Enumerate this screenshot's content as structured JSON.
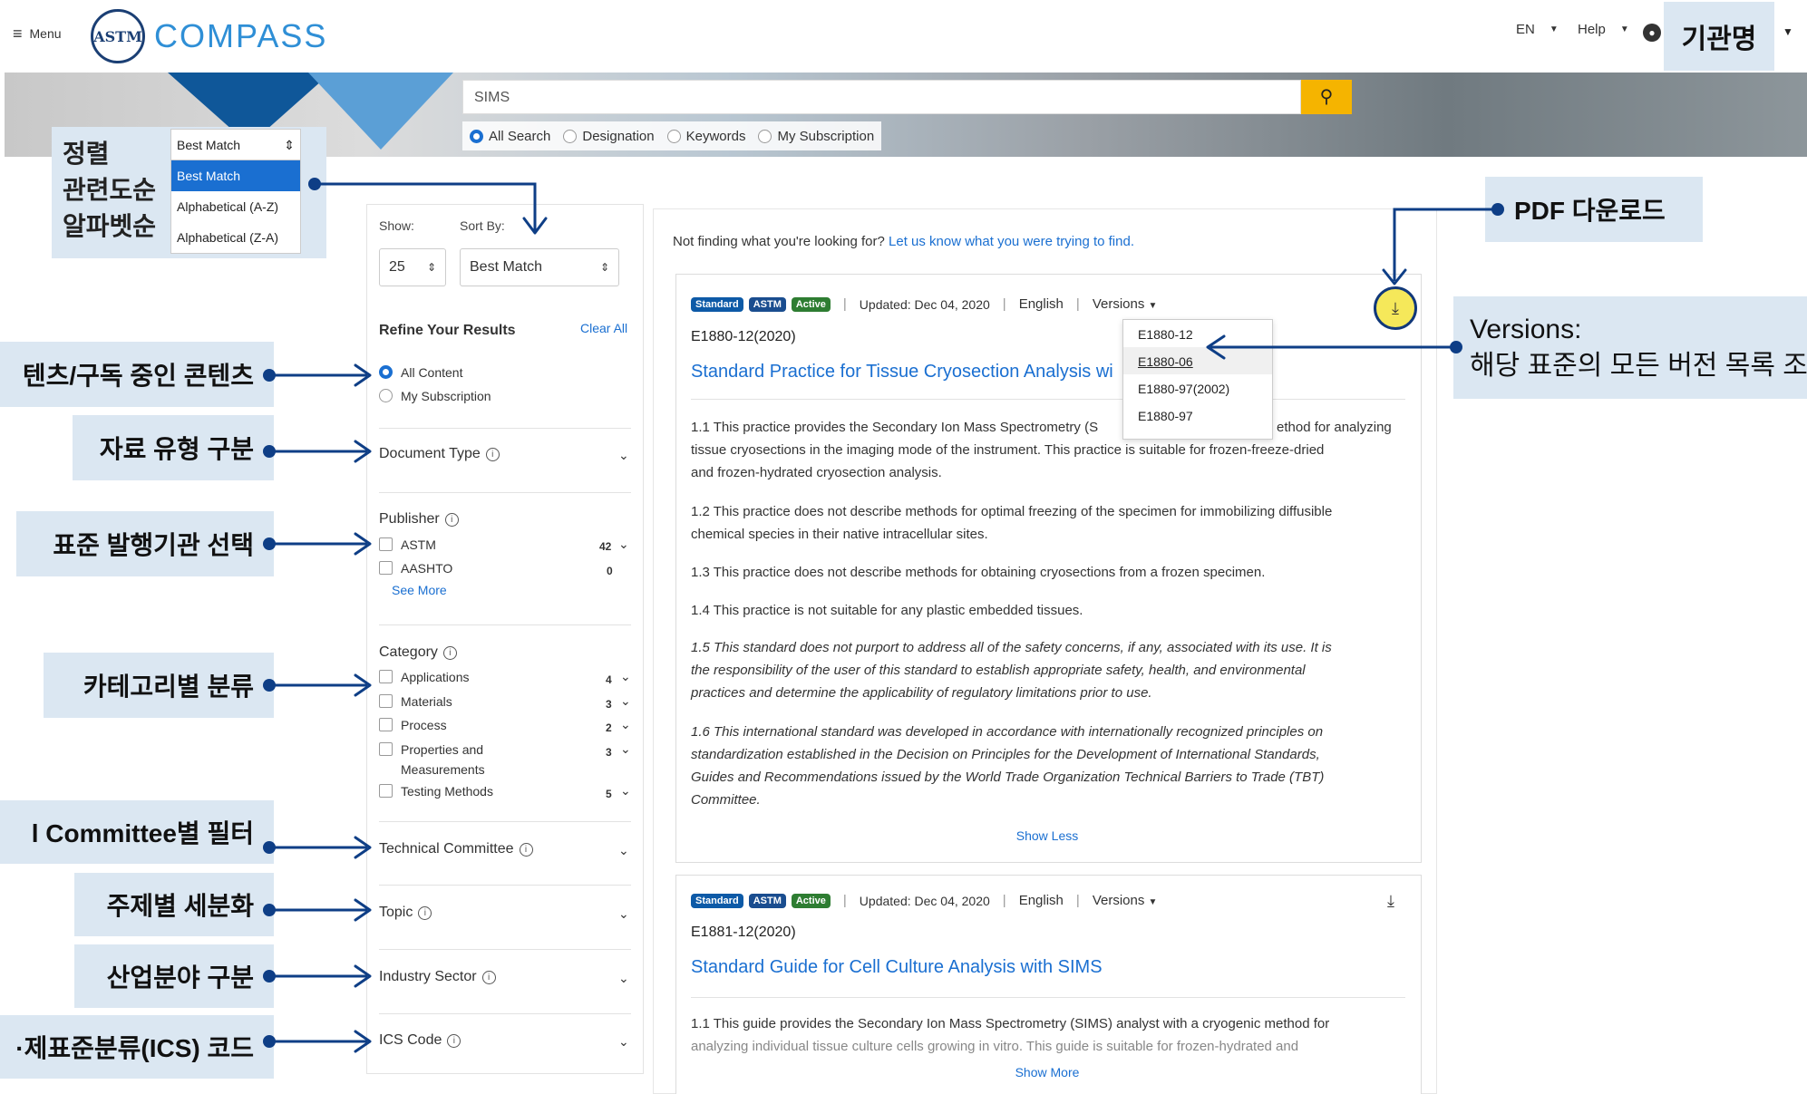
{
  "header": {
    "menu": "Menu",
    "logo_seal": "ASTM",
    "logo": "COMPASS",
    "lang": "EN",
    "help": "Help",
    "org": "기관명"
  },
  "search": {
    "query": "SIMS",
    "options": [
      "All Search",
      "Designation",
      "Keywords",
      "My Subscription"
    ]
  },
  "sort_annot": {
    "lines": [
      "정렬",
      "관련도순",
      "알파벳순"
    ]
  },
  "sort_dropdown": {
    "selected": "Best Match",
    "items": [
      "Best Match",
      "Alphabetical (A-Z)",
      "Alphabetical (Z-A)"
    ]
  },
  "sidebar": {
    "show_label": "Show:",
    "sort_label": "Sort By:",
    "show_value": "25",
    "sort_value": "Best Match",
    "refine": "Refine Your Results",
    "clear_all": "Clear All",
    "content": [
      "All Content",
      "My Subscription"
    ],
    "document_type": "Document Type",
    "publisher": {
      "title": "Publisher",
      "items": [
        {
          "label": "ASTM",
          "count": "42"
        },
        {
          "label": "AASHTO",
          "count": "0"
        }
      ],
      "see_more": "See More"
    },
    "category": {
      "title": "Category",
      "items": [
        {
          "label": "Applications",
          "count": "4"
        },
        {
          "label": "Materials",
          "count": "3"
        },
        {
          "label": "Process",
          "count": "2"
        },
        {
          "label": "Properties and",
          "label2": "Measurements",
          "count": "3"
        },
        {
          "label": "Testing Methods",
          "count": "5"
        }
      ]
    },
    "technical_committee": "Technical Committee",
    "topic": "Topic",
    "industry_sector": "Industry Sector",
    "ics_code": "ICS Code"
  },
  "annotations": {
    "content": "텐츠/구독 중인 콘텐츠",
    "doctype": "자료 유형 구분",
    "publisher": "표준 발행기관 선택",
    "category": "카테고리별 분류",
    "committee": "l Committee별 필터",
    "topic": "주제별 세분화",
    "industry": "산업분야 구분",
    "ics": "·제표준분류(ICS) 코드",
    "pdf": "PDF 다운로드",
    "versions_title": "Versions:",
    "versions_desc": "해당 표준의 모든 버전 목록 조"
  },
  "not_finding": {
    "text": "Not finding what you're looking for? ",
    "link": "Let us know what you were trying to find."
  },
  "results": [
    {
      "badges": [
        "Standard",
        "ASTM",
        "Active"
      ],
      "updated": "Updated: Dec 04, 2020",
      "lang": "English",
      "versions": "Versions",
      "designation": "E1880-12(2020)",
      "title": "Standard Practice for Tissue Cryosection Analysis wi",
      "paragraphs": [
        "1.1 This practice provides the Secondary Ion Mass Spectrometry (S",
        "ethod for analyzing",
        "tissue cryosections in the imaging mode of the instrument. This practice is suitable for frozen-freeze-dried",
        "and frozen-hydrated cryosection analysis.",
        "1.2 This practice does not describe methods for optimal freezing of the specimen for immobilizing diffusible",
        "chemical species in their native intracellular sites.",
        "1.3 This practice does not describe methods for obtaining cryosections from a frozen specimen.",
        "1.4 This practice is not suitable for any plastic embedded tissues.",
        "1.5 This standard does not purport to address all of the safety concerns, if any, associated with its use. It is",
        "the responsibility of the user of this standard to establish appropriate safety, health, and environmental",
        "practices and determine the applicability of regulatory limitations prior to use.",
        "1.6 This international standard was developed in accordance with internationally recognized principles on",
        "standardization established in the Decision on Principles for the Development of International Standards,",
        "Guides and Recommendations issued by the World Trade Organization Technical Barriers to Trade (TBT)",
        "Committee."
      ],
      "show": "Show Less"
    },
    {
      "badges": [
        "Standard",
        "ASTM",
        "Active"
      ],
      "updated": "Updated: Dec 04, 2020",
      "lang": "English",
      "versions": "Versions",
      "designation": "E1881-12(2020)",
      "title": "Standard Guide for Cell Culture Analysis with SIMS",
      "paragraphs": [
        "1.1 This guide provides the Secondary Ion Mass Spectrometry (SIMS) analyst with a cryogenic method for",
        "analyzing individual tissue culture cells growing in vitro. This guide is suitable for frozen-hydrated and"
      ],
      "show": "Show More"
    }
  ],
  "versions_list": [
    "E1880-12",
    "E1880-06",
    "E1880-97(2002)",
    "E1880-97"
  ]
}
